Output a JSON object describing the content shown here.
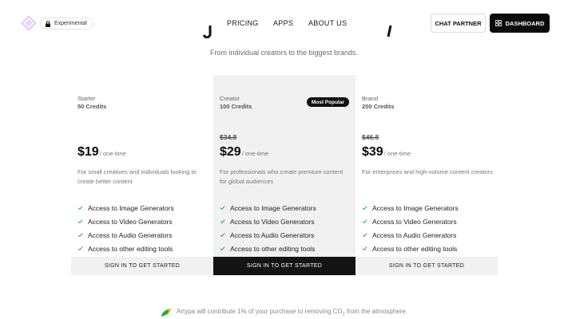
{
  "header": {
    "badge_label": "Experimental",
    "nav": {
      "pricing": "PRICING",
      "apps": "APPS",
      "about": "ABOUT US"
    },
    "chat_label": "CHAT PARTNER",
    "dashboard_label": "DASHBOARD"
  },
  "subtitle": "From individual creators to the biggest brands.",
  "plans": [
    {
      "name": "Starter",
      "credits": "50 Credits",
      "price": "$19",
      "period": "/ one-time",
      "description": "For small creatives and individuals looking to create better content",
      "cta": "SIGN IN TO GET STARTED"
    },
    {
      "name": "Creator",
      "credits": "100 Credits",
      "badge": "Most Popular",
      "old_price": "$34.8",
      "price": "$29",
      "period": "/ one-time",
      "description": "For professionals who create premium content for global audiences",
      "cta": "SIGN IN TO GET STARTED"
    },
    {
      "name": "Brand",
      "credits": "200 Credits",
      "old_price": "$46.8",
      "price": "$39",
      "period": "/ one-time",
      "description": "For enterprises and high-volume content creators",
      "cta": "SIGN IN TO GET STARTED"
    }
  ],
  "features": [
    "Access to Image Generators",
    "Access to Video Generators",
    "Access to Audio Generators",
    "Access to other editing tools"
  ],
  "footer": {
    "text_before": "Artypa will contribute 1% of your purchase to removing CO",
    "subscript": "2",
    "text_after": " from the atmosphere."
  },
  "colors": {
    "accent_logo": "#c7a6f2",
    "check": "#2f9e5a",
    "dark": "#0b0b0b",
    "highlight_bg": "#f1f1f1",
    "leaf": "#3dbb3d"
  },
  "icons": [
    "logo-icon",
    "lock-icon",
    "grid-icon",
    "check-icon",
    "leaf-icon"
  ]
}
